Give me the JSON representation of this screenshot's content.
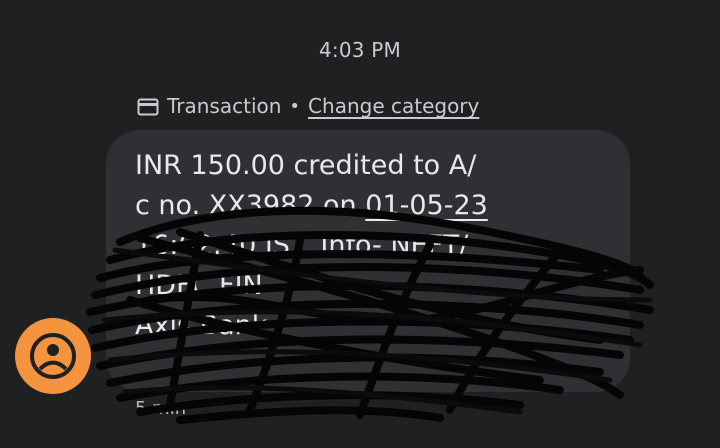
{
  "status": {
    "time": "4:03 PM"
  },
  "message": {
    "category": "Transaction",
    "separator": "•",
    "change_category_label": "Change category",
    "lines": [
      "INR 150.00 credited to A/",
      "c no. XX3982 on ",
      "01-05-23",
      "16:02:40 IST. Info- NEFT/",
      "HDFC FIN",
      "Axis Bank"
    ],
    "timestamp": "5 min"
  },
  "colors": {
    "background": "#1f2022",
    "bubble": "#2f3033",
    "avatar": "#f4943e",
    "text": "#e8e9ed"
  }
}
